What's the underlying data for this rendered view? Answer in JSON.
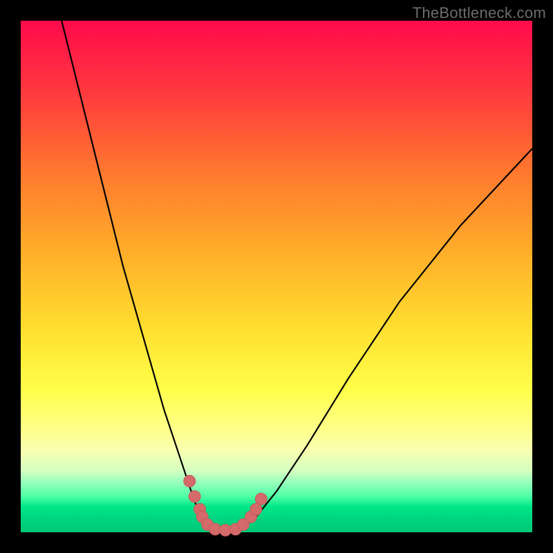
{
  "watermark": "TheBottleneck.com",
  "colors": {
    "background": "#000000",
    "gradient_top": "#ff0a4c",
    "gradient_bottom": "#00c877",
    "curve_stroke": "#000000",
    "dot_fill": "#d46a6a",
    "dot_stroke": "#c85a5a"
  },
  "chart_data": {
    "type": "line",
    "title": "",
    "xlabel": "",
    "ylabel": "",
    "xlim": [
      0,
      100
    ],
    "ylim": [
      0,
      100
    ],
    "series": [
      {
        "name": "left-curve",
        "x": [
          8,
          12,
          16,
          20,
          24,
          28,
          30,
          32,
          34,
          35.5,
          37
        ],
        "y": [
          100,
          84,
          68,
          52,
          38,
          24,
          18,
          12,
          6,
          2.5,
          0.5
        ]
      },
      {
        "name": "valley-floor",
        "x": [
          37,
          40,
          43
        ],
        "y": [
          0.5,
          0.3,
          0.5
        ]
      },
      {
        "name": "right-curve",
        "x": [
          43,
          46,
          50,
          56,
          64,
          74,
          86,
          100
        ],
        "y": [
          0.5,
          3,
          8,
          17,
          30,
          45,
          60,
          75
        ]
      },
      {
        "name": "valley-dots",
        "x": [
          33,
          34,
          35,
          35.5,
          36.5,
          38,
          40,
          42,
          43.5,
          45,
          46,
          47
        ],
        "y": [
          10,
          7,
          4.5,
          3,
          1.5,
          0.6,
          0.4,
          0.6,
          1.5,
          3,
          4.5,
          6.5
        ]
      }
    ]
  }
}
